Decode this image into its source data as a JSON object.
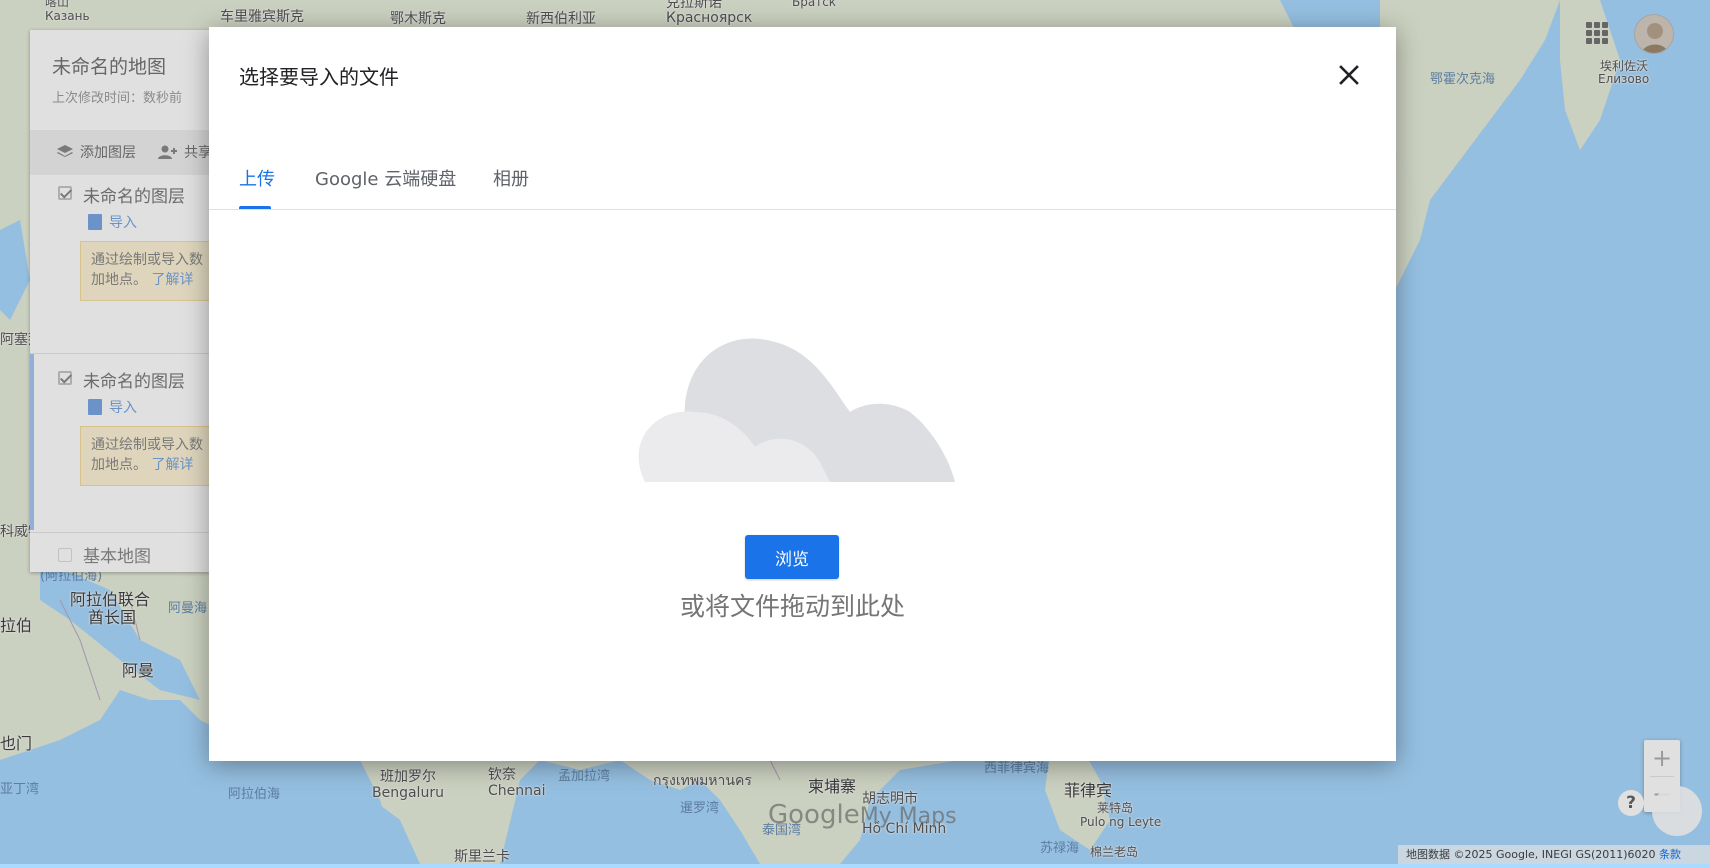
{
  "map": {
    "labels": [
      {
        "t": "喀山",
        "cls": "small"
      },
      {
        "t": "Казань",
        "cls": "small"
      },
      {
        "t": "车里雅宾斯克",
        "cls": ""
      },
      {
        "t": "鄂木斯克",
        "cls": ""
      },
      {
        "t": "新西伯利亚",
        "cls": ""
      },
      {
        "t": "克拉斯诺",
        "cls": ""
      },
      {
        "t": "Красноярск",
        "cls": ""
      },
      {
        "t": "Братск",
        "cls": "small"
      },
      {
        "t": "鄂霍次克海",
        "cls": "sea"
      },
      {
        "t": "埃利佐沃",
        "cls": "small"
      },
      {
        "t": "Елизово",
        "cls": "small"
      },
      {
        "t": "阿塞拜",
        "cls": ""
      },
      {
        "t": "科威特",
        "cls": ""
      },
      {
        "t": "(阿拉伯海)",
        "cls": "sea"
      },
      {
        "t": "阿拉伯联合",
        "cls": "big"
      },
      {
        "t": "酋长国",
        "cls": "big"
      },
      {
        "t": "阿曼海",
        "cls": "sea"
      },
      {
        "t": "拉伯",
        "cls": "big"
      },
      {
        "t": "阿曼",
        "cls": "big"
      },
      {
        "t": "也门",
        "cls": "big"
      },
      {
        "t": "亚丁湾",
        "cls": "sea"
      },
      {
        "t": "阿拉伯海",
        "cls": "sea"
      },
      {
        "t": "班加罗尔",
        "cls": ""
      },
      {
        "t": "Bengaluru",
        "cls": ""
      },
      {
        "t": "钦奈",
        "cls": ""
      },
      {
        "t": "Chennai",
        "cls": ""
      },
      {
        "t": "孟加拉湾",
        "cls": "sea"
      },
      {
        "t": "กรุงเทพมหานคร",
        "cls": ""
      },
      {
        "t": "柬埔寨",
        "cls": "big"
      },
      {
        "t": "胡志明市",
        "cls": ""
      },
      {
        "t": "Hồ Chí Minh",
        "cls": ""
      },
      {
        "t": "西菲律宾海",
        "cls": "sea"
      },
      {
        "t": "菲律宾",
        "cls": "big"
      },
      {
        "t": "莱特岛",
        "cls": "small"
      },
      {
        "t": "Pulo ng Leyte",
        "cls": "small"
      },
      {
        "t": "苏禄海",
        "cls": "sea"
      },
      {
        "t": "棉兰老岛",
        "cls": "small"
      },
      {
        "t": "斯里兰卡",
        "cls": ""
      },
      {
        "t": "暹罗湾",
        "cls": "sea"
      },
      {
        "t": "泰国湾",
        "cls": "sea"
      }
    ]
  },
  "panel": {
    "title": "未命名的地图",
    "subtitle": "上次修改时间：数秒前",
    "add_layer": "添加图层",
    "share": "共享",
    "layers": [
      {
        "name": "未命名的图层",
        "import": "导入",
        "hint_line1": "通过绘制或导入数",
        "hint_line2": "加地点。",
        "hint_link": "了解详"
      },
      {
        "name": "未命名的图层",
        "import": "导入",
        "hint_line1": "通过绘制或导入数",
        "hint_line2": "加地点。",
        "hint_link": "了解详"
      }
    ],
    "base_map": "基本地图"
  },
  "dialog": {
    "title": "选择要导入的文件",
    "tabs": [
      "上传",
      "Google 云端硬盘",
      "相册"
    ],
    "active_tab": 0,
    "browse_label": "浏览",
    "drop_hint": "或将文件拖动到此处"
  },
  "controls": {
    "zoom_in": "+",
    "zoom_out": "−",
    "help": "?"
  },
  "branding": {
    "google": "Google",
    "mymaps": "My Maps"
  },
  "attribution": {
    "text": "地图数据 ©2025 Google, INEGI GS(2011)6020",
    "terms": "条款"
  },
  "colors": {
    "accent": "#1a73e8",
    "water": "#aadaff",
    "land": "#e8eedb",
    "hint_bg": "#fdf3d6"
  }
}
